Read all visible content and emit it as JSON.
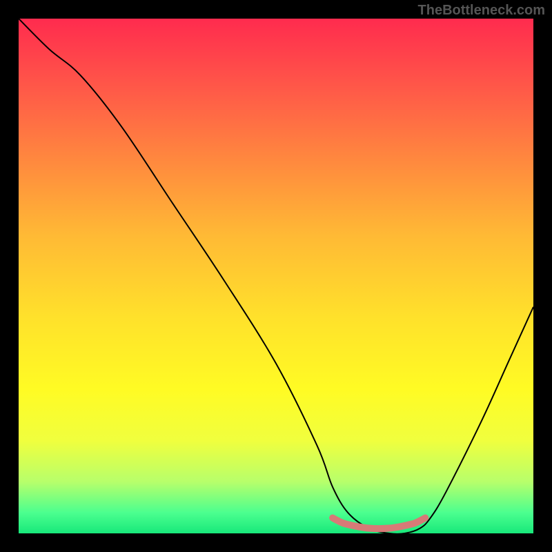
{
  "watermark": "TheBottleneck.com",
  "chart_data": {
    "type": "line",
    "title": "",
    "xlabel": "",
    "ylabel": "",
    "xlim": [
      0,
      100
    ],
    "ylim": [
      0,
      100
    ],
    "series": [
      {
        "name": "bottleneck-curve",
        "x": [
          0,
          6,
          12,
          20,
          30,
          40,
          50,
          58,
          61,
          64,
          68,
          72,
          75,
          78,
          80,
          83,
          90,
          95,
          100
        ],
        "values": [
          100,
          94,
          89,
          79,
          64,
          49,
          33,
          17,
          9,
          4,
          1,
          0,
          0,
          1,
          3,
          8,
          22,
          33,
          44
        ],
        "stroke": "#000000",
        "stroke_width": 2
      },
      {
        "name": "highlight-segment",
        "x": [
          61,
          63,
          65,
          68,
          72,
          75,
          77,
          79
        ],
        "values": [
          3,
          2,
          1.5,
          1,
          1,
          1.5,
          2,
          3
        ],
        "stroke": "#d77a77",
        "stroke_width": 10
      }
    ],
    "gradient_stops": [
      {
        "offset": 0.0,
        "color": "#ff2b4e"
      },
      {
        "offset": 0.14,
        "color": "#ff5a48"
      },
      {
        "offset": 0.28,
        "color": "#ff8a3e"
      },
      {
        "offset": 0.42,
        "color": "#ffb935"
      },
      {
        "offset": 0.58,
        "color": "#ffe12b"
      },
      {
        "offset": 0.72,
        "color": "#fffb24"
      },
      {
        "offset": 0.82,
        "color": "#f0ff3e"
      },
      {
        "offset": 0.9,
        "color": "#b7ff6b"
      },
      {
        "offset": 0.96,
        "color": "#4bff8f"
      },
      {
        "offset": 1.0,
        "color": "#18e87a"
      }
    ]
  }
}
